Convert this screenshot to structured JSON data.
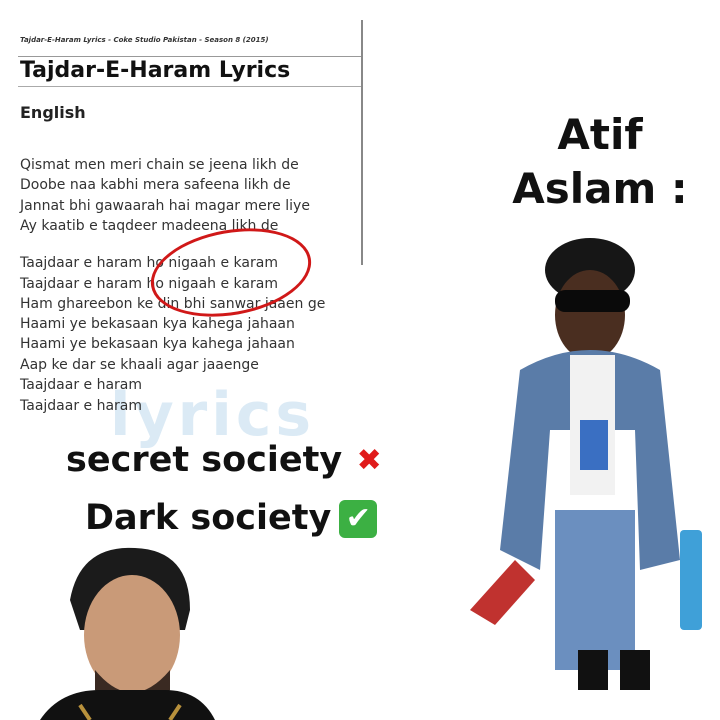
{
  "lyrics_page": {
    "subtitle": "Tajdar-E-Haram Lyrics - Coke Studio Pakistan - Season 8 (2015)",
    "title": "Tajdar-E-Haram Lyrics",
    "language": "English",
    "watermark": "lyrics",
    "lines": [
      "Qismat men meri chain se jeena likh de",
      "Doobe naa kabhi mera safeena likh de",
      "Jannat bhi gawaarah hai magar mere liye",
      "Ay kaatib e taqdeer madeena likh de",
      "Taajdaar e haram ho nigaah e karam",
      "Taajdaar e haram ho nigaah e karam",
      "Ham ghareebon ke din bhi sanwar jaaen ge",
      "Haami ye bekasaan kya kahega jahaan",
      "Haami ye bekasaan kya kahega jahaan",
      "Aap ke dar se khaali agar jaaenge",
      "Taajdaar e haram",
      "Taajdaar e haram"
    ]
  },
  "meme": {
    "label_line1": "Atif",
    "label_line2": "Aslam :",
    "caption1": "secret society",
    "caption1_icon": "cross-mark-icon",
    "caption2": "Dark society",
    "caption2_icon": "check-mark-icon",
    "cross_glyph": "✖",
    "check_glyph": "✔"
  }
}
